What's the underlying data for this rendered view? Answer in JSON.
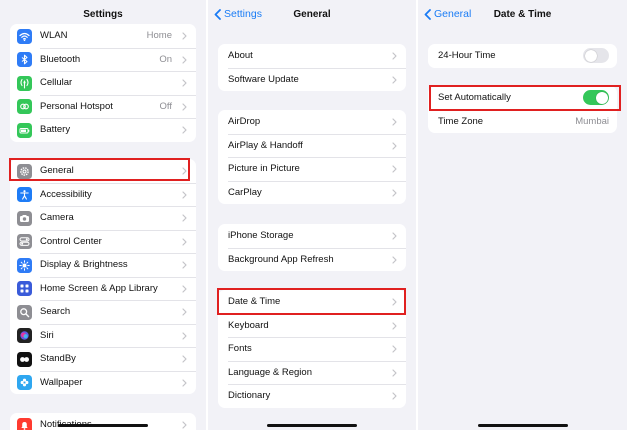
{
  "settings": {
    "title": "Settings",
    "group1": [
      {
        "label": "WLAN",
        "value": "Home",
        "icon": "wifi-icon",
        "color": "#2f7cf6"
      },
      {
        "label": "Bluetooth",
        "value": "On",
        "icon": "bluetooth-icon",
        "color": "#2f7cf6"
      },
      {
        "label": "Cellular",
        "value": "",
        "icon": "antenna-icon",
        "color": "#34c759"
      },
      {
        "label": "Personal Hotspot",
        "value": "Off",
        "icon": "hotspot-icon",
        "color": "#34c759"
      },
      {
        "label": "Battery",
        "value": "",
        "icon": "battery-icon",
        "color": "#34c759"
      }
    ],
    "group2": [
      {
        "label": "General",
        "icon": "gear-icon",
        "color": "#8e8e93"
      },
      {
        "label": "Accessibility",
        "icon": "accessibility-icon",
        "color": "#1e7cf6"
      },
      {
        "label": "Camera",
        "icon": "camera-icon",
        "color": "#8e8e93"
      },
      {
        "label": "Control Center",
        "icon": "switches-icon",
        "color": "#8e8e93"
      },
      {
        "label": "Display & Brightness",
        "icon": "sun-icon",
        "color": "#2f7cf6"
      },
      {
        "label": "Home Screen & App Library",
        "icon": "grid-icon",
        "color": "#3a5bd9"
      },
      {
        "label": "Search",
        "icon": "search-icon",
        "color": "#8e8e93"
      },
      {
        "label": "Siri",
        "icon": "siri-icon",
        "color": "#222222"
      },
      {
        "label": "StandBy",
        "icon": "standby-icon",
        "color": "#111111"
      },
      {
        "label": "Wallpaper",
        "icon": "flower-icon",
        "color": "#2fa7f0"
      }
    ],
    "group3": [
      {
        "label": "Notifications",
        "icon": "bell-icon",
        "color": "#ff3b30"
      }
    ]
  },
  "general": {
    "back_label": "Settings",
    "title": "General",
    "groups": [
      [
        "About",
        "Software Update"
      ],
      [
        "AirDrop",
        "AirPlay & Handoff",
        "Picture in Picture",
        "CarPlay"
      ],
      [
        "iPhone Storage",
        "Background App Refresh"
      ],
      [
        "Date & Time",
        "Keyboard",
        "Fonts",
        "Language & Region",
        "Dictionary"
      ]
    ]
  },
  "datetime": {
    "back_label": "General",
    "title": "Date & Time",
    "hour24": {
      "label": "24-Hour Time",
      "on": false
    },
    "set_auto": {
      "label": "Set Automatically",
      "on": true
    },
    "timezone": {
      "label": "Time Zone",
      "value": "Mumbai"
    }
  },
  "colors": {
    "accent": "#1a7cf5",
    "toggle_on": "#34c759",
    "toggle_off": "#e5e5ea",
    "highlight": "#e02020"
  }
}
